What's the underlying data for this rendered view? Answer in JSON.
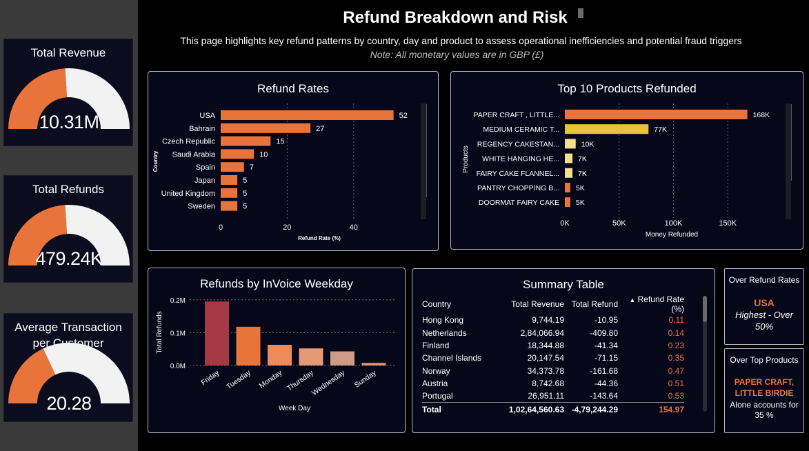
{
  "header": {
    "title": "Refund Breakdown and Risk",
    "subtitle": "This page highlights key refund patterns by country, day and product to assess operational inefficiencies and potential fraud triggers",
    "note": "Note: All monetary values are in GBP (£)"
  },
  "kpis": [
    {
      "title_line1": "Total Revenue",
      "title_line2": "",
      "value": "10.31M",
      "fill_fraction": 0.48
    },
    {
      "title_line1": "Total Refunds",
      "title_line2": "",
      "value": "479.24K",
      "fill_fraction": 0.48
    },
    {
      "title_line1": "Average Transaction",
      "title_line2": "per Customer",
      "value": "20.28",
      "fill_fraction": 0.36
    }
  ],
  "colors": {
    "accent": "#e8743b",
    "gauge_empty": "#f2f2f2",
    "panel_bg": "#07071a",
    "yellow": "#e6c33a",
    "pale_yellow": "#f3e08c",
    "crimson": "#a63a44"
  },
  "refund_rates": {
    "title": "Refund Rates",
    "ylabel": "Country",
    "xlabel": "Refund Rate (%)",
    "xticks": [
      "0",
      "20",
      "40"
    ],
    "chart_data": {
      "type": "bar",
      "orientation": "horizontal",
      "categories": [
        "USA",
        "Bahrain",
        "Czech Republic",
        "Saudi Arabia",
        "Spain",
        "Japan",
        "United Kingdom",
        "Sweden"
      ],
      "values": [
        52,
        27,
        15,
        10,
        7,
        5,
        5,
        5
      ],
      "xlim": [
        0,
        52
      ]
    }
  },
  "top_products": {
    "title": "Top 10 Products Refunded",
    "ylabel": "Products",
    "xlabel": "Money Refunded",
    "xticks": [
      "0K",
      "50K",
      "100K",
      "150K"
    ],
    "chart_data": {
      "type": "bar",
      "orientation": "horizontal",
      "categories": [
        "PAPER CRAFT , LITTLE...",
        "MEDIUM CERAMIC T...",
        "REGENCY CAKESTAN...",
        "WHITE HANGING HE...",
        "FAIRY CAKE FLANNEL...",
        "PANTRY CHOPPING B...",
        "DOORMAT FAIRY CAKE"
      ],
      "values": [
        168,
        77,
        10,
        7,
        7,
        5,
        5
      ],
      "labels": [
        "168K",
        "77K",
        "10K",
        "7K",
        "7K",
        "5K",
        "5K"
      ],
      "bar_colors": [
        "#e8743b",
        "#e6c33a",
        "#f3e08c",
        "#f3e08c",
        "#f3e08c",
        "#e8743b",
        "#e8743b"
      ],
      "xlim": [
        0,
        168
      ]
    }
  },
  "weekday": {
    "title": "Refunds by InVoice Weekday",
    "ylabel": "Total Refunds",
    "xlabel": "Week Day",
    "yticks": [
      "0.0M",
      "0.1M",
      "0.2M"
    ],
    "chart_data": {
      "type": "bar",
      "categories": [
        "Friday",
        "Tuesday",
        "Monday",
        "Thursday",
        "Wednesday",
        "Sunday"
      ],
      "values": [
        0.195,
        0.118,
        0.063,
        0.052,
        0.043,
        0.008
      ],
      "bar_colors": [
        "#a63a44",
        "#e8743b",
        "#ec8a5a",
        "#e59a76",
        "#cf9a88",
        "#d4937a"
      ],
      "ylim": [
        0,
        0.2
      ]
    }
  },
  "summary": {
    "title": "Summary Table",
    "columns": [
      "Country",
      "Total Revenue",
      "Total Refund",
      "Refund Rate (%)"
    ],
    "rows": [
      [
        "Hong Kong",
        "9,744.19",
        "-10.95",
        "0.11"
      ],
      [
        "Netherlands",
        "2,84,066.94",
        "-409.80",
        "0.14"
      ],
      [
        "Finland",
        "18,344.88",
        "-41.34",
        "0.23"
      ],
      [
        "Channel Islands",
        "20,147.54",
        "-71.15",
        "0.35"
      ],
      [
        "Norway",
        "34,373.78",
        "-161.68",
        "0.47"
      ],
      [
        "Austria",
        "8,742.68",
        "-44.36",
        "0.51"
      ],
      [
        "Portugal",
        "26,951.11",
        "-143.64",
        "0.53"
      ]
    ],
    "total": [
      "Total",
      "1,02,64,560.63",
      "-4,79,244.29",
      "154.97"
    ]
  },
  "callouts": {
    "refund_rates": {
      "title": "Over Refund Rates",
      "big": "USA",
      "line1": "Highest - Over",
      "line2": "50%"
    },
    "top_products": {
      "title": "Over Top Products",
      "big1": "PAPER CRAFT,",
      "big2": "LITTLE BIRDIE",
      "line1": "Alone accounts for",
      "line2": "35 %"
    }
  }
}
